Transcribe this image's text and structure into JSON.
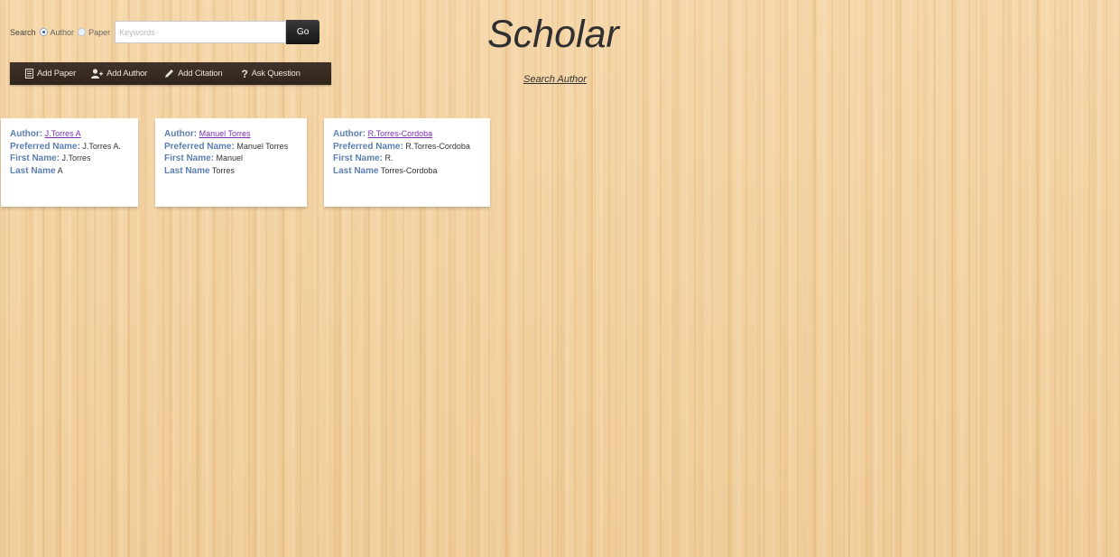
{
  "search": {
    "label": "Search",
    "options": [
      {
        "label": "Author",
        "checked": true
      },
      {
        "label": "Paper",
        "checked": false
      }
    ],
    "placeholder": "Keywords",
    "value": "",
    "go_label": "Go"
  },
  "toolbar": {
    "items": [
      {
        "label": "Add Paper",
        "icon": "document-icon"
      },
      {
        "label": "Add Author",
        "icon": "add-user-icon"
      },
      {
        "label": "Add Citation",
        "icon": "pencil-icon"
      },
      {
        "label": "Ask Question",
        "icon": "question-icon"
      }
    ]
  },
  "header": {
    "title": "Scholar",
    "subtitle_link": "Search Author"
  },
  "fields": {
    "author": "Author:",
    "preferred": "Preferred Name:",
    "first": "First Name:",
    "last": "Last Name"
  },
  "authors": [
    {
      "author": "J.Torres A",
      "preferred": "J.Torres A.",
      "first": "J.Torres",
      "last": "A"
    },
    {
      "author": "Manuel Torres",
      "preferred": "Manuel Torres",
      "first": "Manuel",
      "last": "Torres"
    },
    {
      "author": "R.Torres-Cordoba",
      "preferred": "R.Torres-Cordoba",
      "first": "R.",
      "last": "Torres-Cordoba"
    }
  ],
  "colors": {
    "background": "#f2cf9c",
    "toolbar": "#3a2d22",
    "field_label": "#5b7fb0",
    "link": "#7b2fb5"
  }
}
